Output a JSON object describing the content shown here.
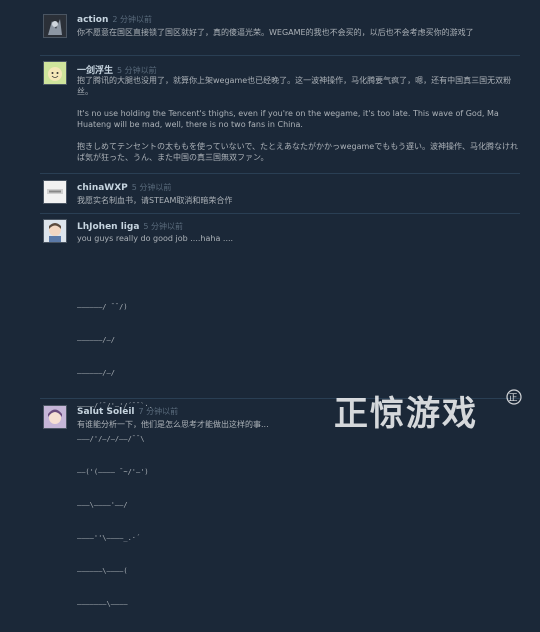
{
  "comments": [
    {
      "author": "action",
      "time": "2 分钟以前",
      "text": "你不愿意在国区直接锁了国区就好了，真的傻逼光荣。WEGAME的我也不会买的，以后也不会考虑买你的游戏了"
    },
    {
      "author": "一剑浮生",
      "time": "5 分钟以前",
      "text": "抱了腾讯的大腿也没用了，就算你上架wegame也已经晚了。这一波神操作，马化腾要气疯了，嗯，还有中国真三国无双粉丝。\n\nIt's no use holding the Tencent's thighs, even if you're on the wegame, it's too late. This wave of God, Ma Huateng will be mad, well, there is no two fans in China.\n\n抱きしめてテンセントの太ももを使っていないで、たとえあなたがかかっwegameでももう遅い。波神操作、马化腾なければ気が狂った、うん、また中国の真三国無双ファン。"
    },
    {
      "author": "chinaWXP",
      "time": "5 分钟以前",
      "text": "我愿实名制血书，请STEAM取消和暗荣合作"
    },
    {
      "author": "LhJohen liga",
      "time": "5 分钟以前",
      "text": "you guys really do good job ....haha ....",
      "art": [
        "——————/ ¯¯/)",
        "——————/—/",
        "——————/—/",
        "————/´¯/'—'/´¯¯`·.",
        "———/'/—/—/——/¯¯\\",
        "——('(———— ¯~/'—')",
        "———\\————'——/",
        "————''\\————_.·´",
        "——————\\————(",
        "———————\\————"
      ]
    },
    {
      "author": "Salut Soleil",
      "time": "7 分钟以前",
      "text": "有谁能分析一下，他们是怎么思考才能做出这样的事..."
    }
  ],
  "watermark": {
    "text": "正惊游戏",
    "mark": "正"
  }
}
